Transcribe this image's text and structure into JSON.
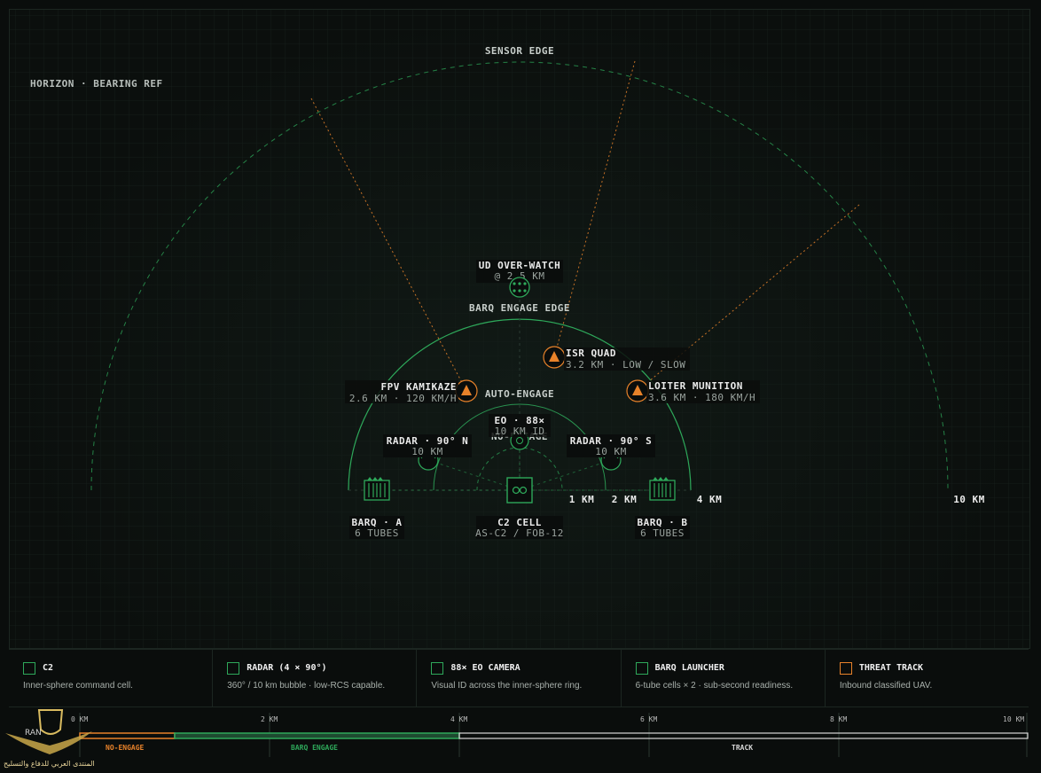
{
  "scene": {
    "horizon_label": "HORIZON · BEARING REF",
    "sensor_edge_label": "SENSOR EDGE",
    "barq_edge_label": "BARQ ENGAGE EDGE",
    "auto_engage_label": "AUTO-ENGAGE",
    "no_engage_label": "NO-ENGAGE",
    "ring_labels": {
      "r1": "1 KM",
      "r2": "2 KM",
      "r4": "4 KM",
      "r10": "10 KM"
    },
    "overwatch": {
      "title": "UD OVER-WATCH",
      "sub": "@ 2.5 KM"
    },
    "eo": {
      "title": "EO · 88×",
      "sub": "10 KM ID"
    },
    "radar_n": {
      "title": "RADAR · 90° N",
      "sub": "10 KM"
    },
    "radar_s": {
      "title": "RADAR · 90° S",
      "sub": "10 KM"
    },
    "barq_a": {
      "title": "BARQ · A",
      "sub": "6 TUBES"
    },
    "barq_b": {
      "title": "BARQ · B",
      "sub": "6 TUBES"
    },
    "c2": {
      "title": "C2 CELL",
      "sub": "AS-C2 / FOB-12"
    },
    "threats": [
      {
        "title": "FPV KAMIKAZE",
        "sub": "2.6 KM · 120 KM/H"
      },
      {
        "title": "ISR QUAD",
        "sub": "3.2 KM · LOW / SLOW"
      },
      {
        "title": "LOITER MUNITION",
        "sub": "3.6 KM · 180 KM/H"
      }
    ]
  },
  "legend": [
    {
      "title": "C2",
      "desc": "Inner-sphere command cell.",
      "color": "#2ea85a"
    },
    {
      "title": "RADAR (4 × 90°)",
      "desc": "360° / 10 km bubble · low-RCS capable.",
      "color": "#2ea85a"
    },
    {
      "title": "88× EO CAMERA",
      "desc": "Visual ID across the inner-sphere ring.",
      "color": "#2ea85a"
    },
    {
      "title": "BARQ LAUNCHER",
      "desc": "6-tube cells × 2 · sub-second readiness.",
      "color": "#2ea85a"
    },
    {
      "title": "THREAT TRACK",
      "desc": "Inbound classified UAV.",
      "color": "#e8822a"
    }
  ],
  "scale": {
    "ticks": [
      "0 KM",
      "2 KM",
      "4 KM",
      "6 KM",
      "8 KM",
      "10 KM"
    ],
    "bands": [
      {
        "label": "NO-ENGAGE",
        "color": "#e8822a"
      },
      {
        "label": "BARQ ENGAGE",
        "color": "#2ea85a"
      },
      {
        "label": "TRACK",
        "color": "#d8d8d8"
      }
    ]
  },
  "watermark": {
    "text": "المنتدى العربي للدفاع والتسليح",
    "logo_text": "RAN"
  },
  "colors": {
    "green": "#2ea85a",
    "orange": "#e8822a",
    "grid": "#16211c"
  }
}
